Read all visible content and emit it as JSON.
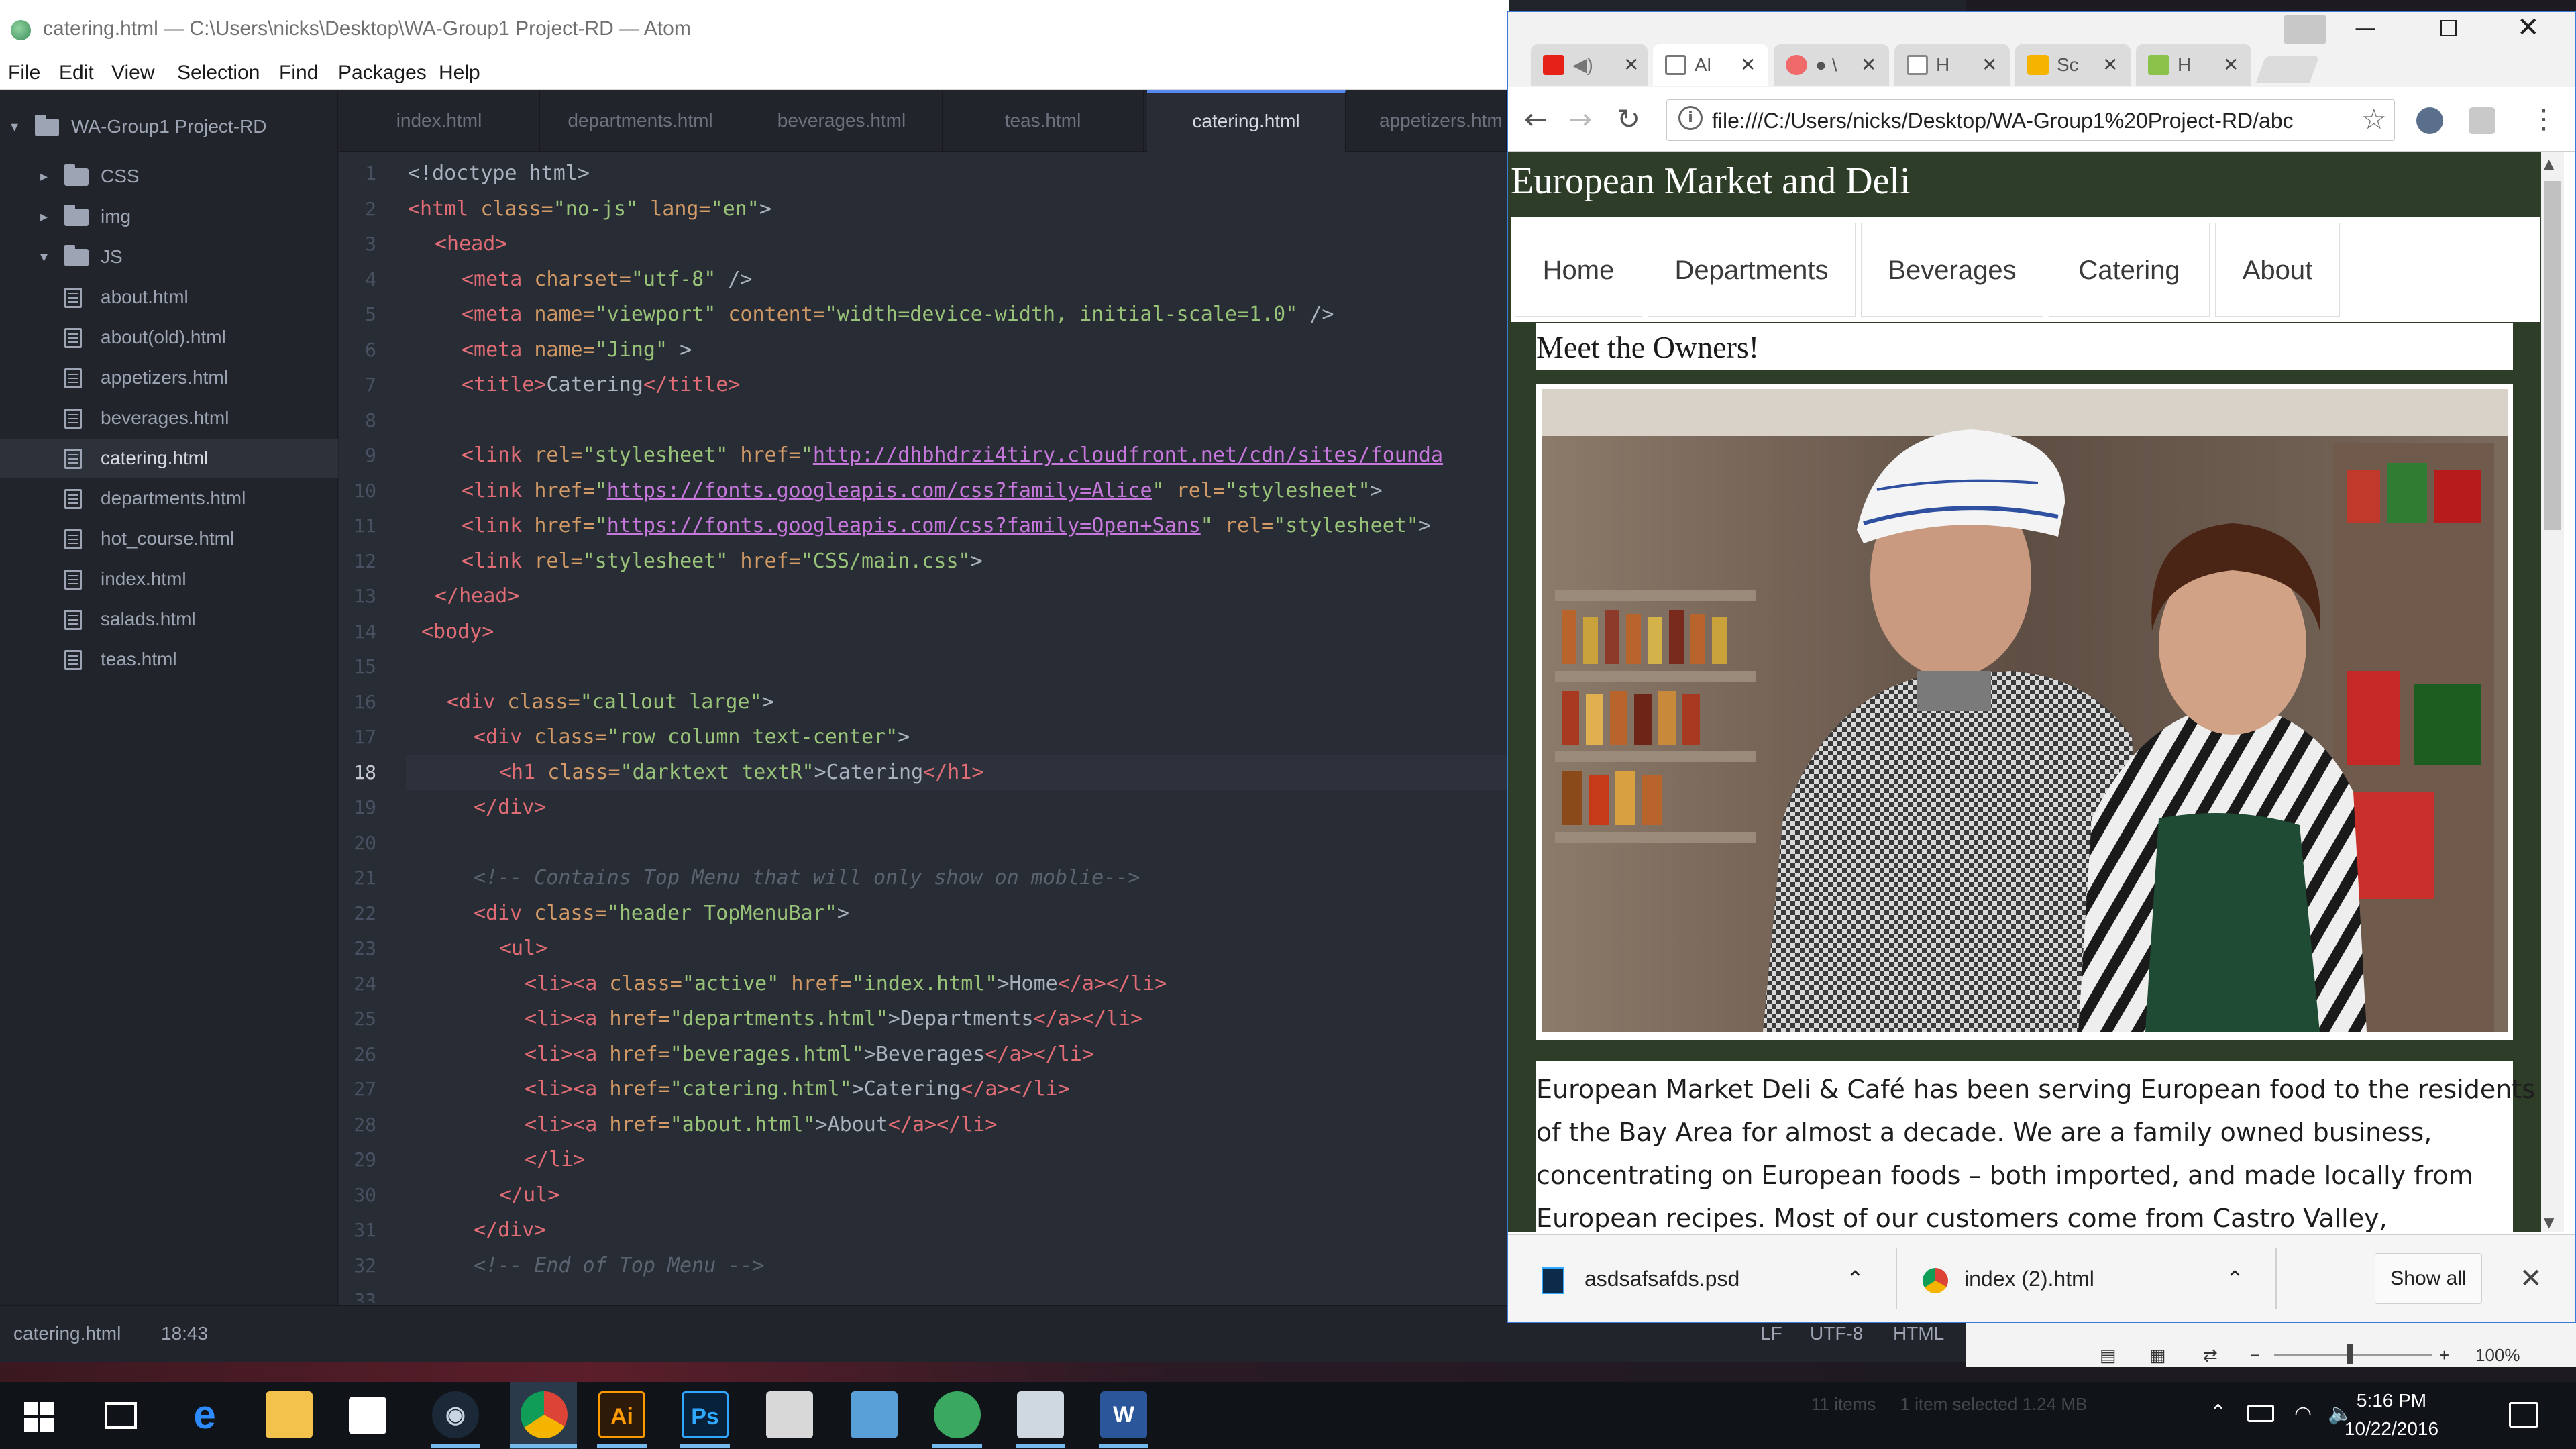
{
  "atom": {
    "title": "catering.html — C:\\Users\\nicks\\Desktop\\WA-Group1 Project-RD — Atom",
    "menu": [
      "File",
      "Edit",
      "View",
      "Selection",
      "Find",
      "Packages",
      "Help"
    ],
    "project_name": "WA-Group1 Project-RD",
    "tree": [
      {
        "label": "CSS",
        "type": "folder",
        "expanded": false
      },
      {
        "label": "img",
        "type": "folder",
        "expanded": false
      },
      {
        "label": "JS",
        "type": "folder",
        "expanded": true
      },
      {
        "label": "about.html",
        "type": "file"
      },
      {
        "label": "about(old).html",
        "type": "file"
      },
      {
        "label": "appetizers.html",
        "type": "file"
      },
      {
        "label": "beverages.html",
        "type": "file"
      },
      {
        "label": "catering.html",
        "type": "file",
        "selected": true
      },
      {
        "label": "departments.html",
        "type": "file"
      },
      {
        "label": "hot_course.html",
        "type": "file"
      },
      {
        "label": "index.html",
        "type": "file"
      },
      {
        "label": "salads.html",
        "type": "file"
      },
      {
        "label": "teas.html",
        "type": "file"
      }
    ],
    "tabs": [
      "index.html",
      "departments.html",
      "beverages.html",
      "teas.html",
      "catering.html",
      "appetizers.htm"
    ],
    "active_tab": "catering.html",
    "line_numbers": [
      "1",
      "2",
      "3",
      "4",
      "5",
      "6",
      "7",
      "8",
      "9",
      "10",
      "11",
      "12",
      "13",
      "14",
      "15",
      "16",
      "17",
      "18",
      "19",
      "20",
      "21",
      "22",
      "23",
      "24",
      "25",
      "26",
      "27",
      "28",
      "29",
      "30",
      "31",
      "32",
      "33"
    ],
    "current_line": "18",
    "code": {
      "l1a": "<!doctype html>",
      "l2_tag": "<html",
      "l2_a1": " class=",
      "l2_s1": "\"no-js\"",
      "l2_a2": " lang=",
      "l2_s2": "\"en\"",
      "l2_end": ">",
      "l3": "<head>",
      "l4_tag": "<meta",
      "l4_a": " charset=",
      "l4_s": "\"utf-8\"",
      "l4_end": " />",
      "l5_tag": "<meta",
      "l5_a1": " name=",
      "l5_s1": "\"viewport\"",
      "l5_a2": " content=",
      "l5_s2": "\"width=device-width, initial-scale=1.0\"",
      "l5_end": " />",
      "l6_tag": "<meta",
      "l6_a": " name=",
      "l6_s": "\"Jing\"",
      "l6_end": " >",
      "l7_t1": "<title>",
      "l7_txt": "Catering",
      "l7_t2": "</title>",
      "l9_tag": "<link",
      "l9_a1": " rel=",
      "l9_s1": "\"stylesheet\"",
      "l9_a2": " href=",
      "l9_u": "http://dhbhdrzi4tiry.cloudfront.net/cdn/sites/founda",
      "l10_tag": "<link",
      "l10_a1": " href=",
      "l10_q1": "\"",
      "l10_u": "https://fonts.googleapis.com/css?family=Alice",
      "l10_q2": "\"",
      "l10_a2": " rel=",
      "l10_s2": "\"stylesheet\"",
      "l10_end": ">",
      "l11_tag": "<link",
      "l11_a1": " href=",
      "l11_q1": "\"",
      "l11_u": "https://fonts.googleapis.com/css?family=Open+Sans",
      "l11_q2": "\"",
      "l11_a2": " rel=",
      "l11_s2": "\"stylesheet\"",
      "l11_end": ">",
      "l12_tag": "<link",
      "l12_a1": " rel=",
      "l12_s1": "\"stylesheet\"",
      "l12_a2": " href=",
      "l12_s2": "\"CSS/main.css\"",
      "l12_end": ">",
      "l13": "</head>",
      "l14": "<body>",
      "l16_tag": "<div",
      "l16_a": " class=",
      "l16_s": "\"callout large\"",
      "l16_end": ">",
      "l17_tag": "<div",
      "l17_a": " class=",
      "l17_s": "\"row column text-center\"",
      "l17_end": ">",
      "l18_tag": "<h1",
      "l18_a": " class=",
      "l18_s": "\"darktext textR\"",
      "l18_gt": ">",
      "l18_txt": "Catering",
      "l18_close": "</h1>",
      "l19": "</div>",
      "l21": "<!-- Contains Top Menu that will only show on moblie-->",
      "l22_tag": "<div",
      "l22_a": " class=",
      "l22_s": "\"header TopMenuBar\"",
      "l22_end": ">",
      "l23": "<ul>",
      "l24_t": "<li><a",
      "l24_a1": " class=",
      "l24_s1": "\"active\"",
      "l24_a2": " href=",
      "l24_s2": "\"index.html\"",
      "l24_gt": ">",
      "l24_txt": "Home",
      "l24_close": "</a></li>",
      "l25_t": "<li><a",
      "l25_a": " href=",
      "l25_s": "\"departments.html\"",
      "l25_gt": ">",
      "l25_txt": "Departments",
      "l25_close": "</a></li>",
      "l26_t": "<li><a",
      "l26_a": " href=",
      "l26_s": "\"beverages.html\"",
      "l26_gt": ">",
      "l26_txt": "Beverages",
      "l26_close": "</a></li>",
      "l27_t": "<li><a",
      "l27_a": " href=",
      "l27_s": "\"catering.html\"",
      "l27_gt": ">",
      "l27_txt": "Catering",
      "l27_close": "</a></li>",
      "l28_t": "<li><a",
      "l28_a": " href=",
      "l28_s": "\"about.html\"",
      "l28_gt": ">",
      "l28_txt": "About",
      "l28_close": "</a></li>",
      "l29": "</li>",
      "l30": "</ul>",
      "l31": "</div>",
      "l32": "<!-- End of Top Menu -->"
    },
    "status": {
      "file": "catering.html",
      "position": "18:43",
      "line_ending": "LF",
      "encoding": "UTF-8",
      "grammar": "HTML"
    }
  },
  "chrome": {
    "tabs": [
      {
        "label": "",
        "icon": "youtube-icon",
        "color": "#e62117"
      },
      {
        "label": "Al",
        "icon": "page-icon",
        "color": "#888888",
        "active": true
      },
      {
        "label": "● \\",
        "icon": "asana-icon",
        "color": "#f06a6a"
      },
      {
        "label": "H",
        "icon": "page-icon",
        "color": "#888888"
      },
      {
        "label": "Sc",
        "icon": "slides-icon",
        "color": "#f4b400"
      },
      {
        "label": "H",
        "icon": "sheets-icon",
        "color": "#8bc34a"
      }
    ],
    "url": "file:///C:/Users/nicks/Desktop/WA-Group1%20Project-RD/abc",
    "page": {
      "site_title": "European Market and Deli",
      "nav": [
        "Home",
        "Departments",
        "Beverages",
        "Catering",
        "About"
      ],
      "section_title": "Meet the Owners!",
      "body_lines": [
        "European Market Deli & Café has been serving European food to the residents",
        "of the Bay Area for almost a decade. We are a family owned business,",
        "concentrating on European foods – both imported, and made locally from",
        "European recipes. Most of our customers come from Castro Valley,"
      ]
    },
    "downloads": [
      {
        "name": "asdsafsafds.psd",
        "icon": "photoshop-file-icon"
      },
      {
        "name": "index (2).html",
        "icon": "chrome-file-icon"
      }
    ],
    "show_all": "Show all",
    "zoom": "100%"
  },
  "explorer_status": {
    "items": "11 items",
    "selected": "1 item selected  1.24 MB"
  },
  "taskbar": {
    "time": "5:16 PM",
    "date": "10/22/2016"
  },
  "colors": {
    "site_green": "#2e3d28",
    "atom_bg": "#282c34",
    "accent_blue": "#568af2"
  }
}
